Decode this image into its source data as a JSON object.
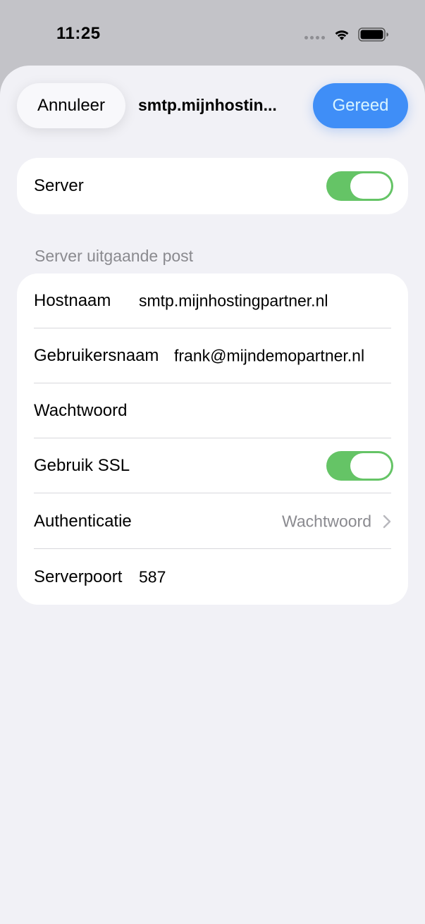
{
  "status_bar": {
    "time": "11:25"
  },
  "nav": {
    "cancel_label": "Annuleer",
    "title": "smtp.mijnhostin...",
    "done_label": "Gereed"
  },
  "server": {
    "label": "Server",
    "enabled": true
  },
  "outgoing": {
    "section_header": "Server uitgaande post",
    "hostname_label": "Hostnaam",
    "hostname_value": "smtp.mijnhostingpartner.nl",
    "username_label": "Gebruikersnaam",
    "username_value": "frank@mijndemopartner.nl",
    "password_label": "Wachtwoord",
    "password_value": "",
    "ssl_label": "Gebruik SSL",
    "ssl_enabled": true,
    "auth_label": "Authenticatie",
    "auth_value": "Wachtwoord",
    "port_label": "Serverpoort",
    "port_value": "587"
  },
  "colors": {
    "accent": "#3f8ef7",
    "toggle_on": "#65c466",
    "secondary_text": "#8a8a8f"
  },
  "icons": [
    "cellular-dots-icon",
    "wifi-icon",
    "battery-icon",
    "chevron-right-icon"
  ]
}
